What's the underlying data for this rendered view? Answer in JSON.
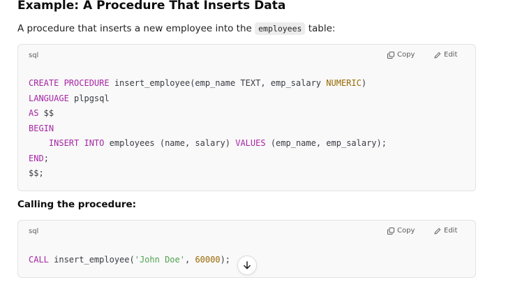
{
  "heading": "Example: A Procedure That Inserts Data",
  "intro": {
    "before": "A procedure that inserts a new employee into the ",
    "code": "employees",
    "after": " table:"
  },
  "calling_heading": "Calling the procedure:",
  "code_blocks": [
    {
      "language": "sql",
      "copy_label": "Copy",
      "edit_label": "Edit",
      "lines": [
        [
          {
            "t": "CREATE PROCEDURE",
            "c": "kw"
          },
          {
            "t": " insert_employee(emp_name TEXT, emp_salary "
          },
          {
            "t": "NUMERIC",
            "c": "ty"
          },
          {
            "t": ")"
          }
        ],
        [
          {
            "t": "LANGUAGE",
            "c": "kw"
          },
          {
            "t": " plpgsql"
          }
        ],
        [
          {
            "t": "AS",
            "c": "kw"
          },
          {
            "t": " $$"
          }
        ],
        [
          {
            "t": "BEGIN",
            "c": "kw"
          }
        ],
        [
          {
            "t": "    "
          },
          {
            "t": "INSERT INTO",
            "c": "kw"
          },
          {
            "t": " employees (name, salary) "
          },
          {
            "t": "VALUES",
            "c": "kw"
          },
          {
            "t": " (emp_name, emp_salary);"
          }
        ],
        [
          {
            "t": "END",
            "c": "kw"
          },
          {
            "t": ";"
          }
        ],
        [
          {
            "t": "$$;"
          }
        ]
      ]
    },
    {
      "language": "sql",
      "copy_label": "Copy",
      "edit_label": "Edit",
      "lines": [
        [
          {
            "t": "CALL",
            "c": "kw"
          },
          {
            "t": " insert_employee("
          },
          {
            "t": "'John Doe'",
            "c": "str"
          },
          {
            "t": ", "
          },
          {
            "t": "60000",
            "c": "num"
          },
          {
            "t": ");"
          }
        ]
      ]
    }
  ],
  "icons": {
    "copy": "copy-icon",
    "edit": "edit-pencil-icon",
    "scroll": "arrow-down-icon"
  }
}
